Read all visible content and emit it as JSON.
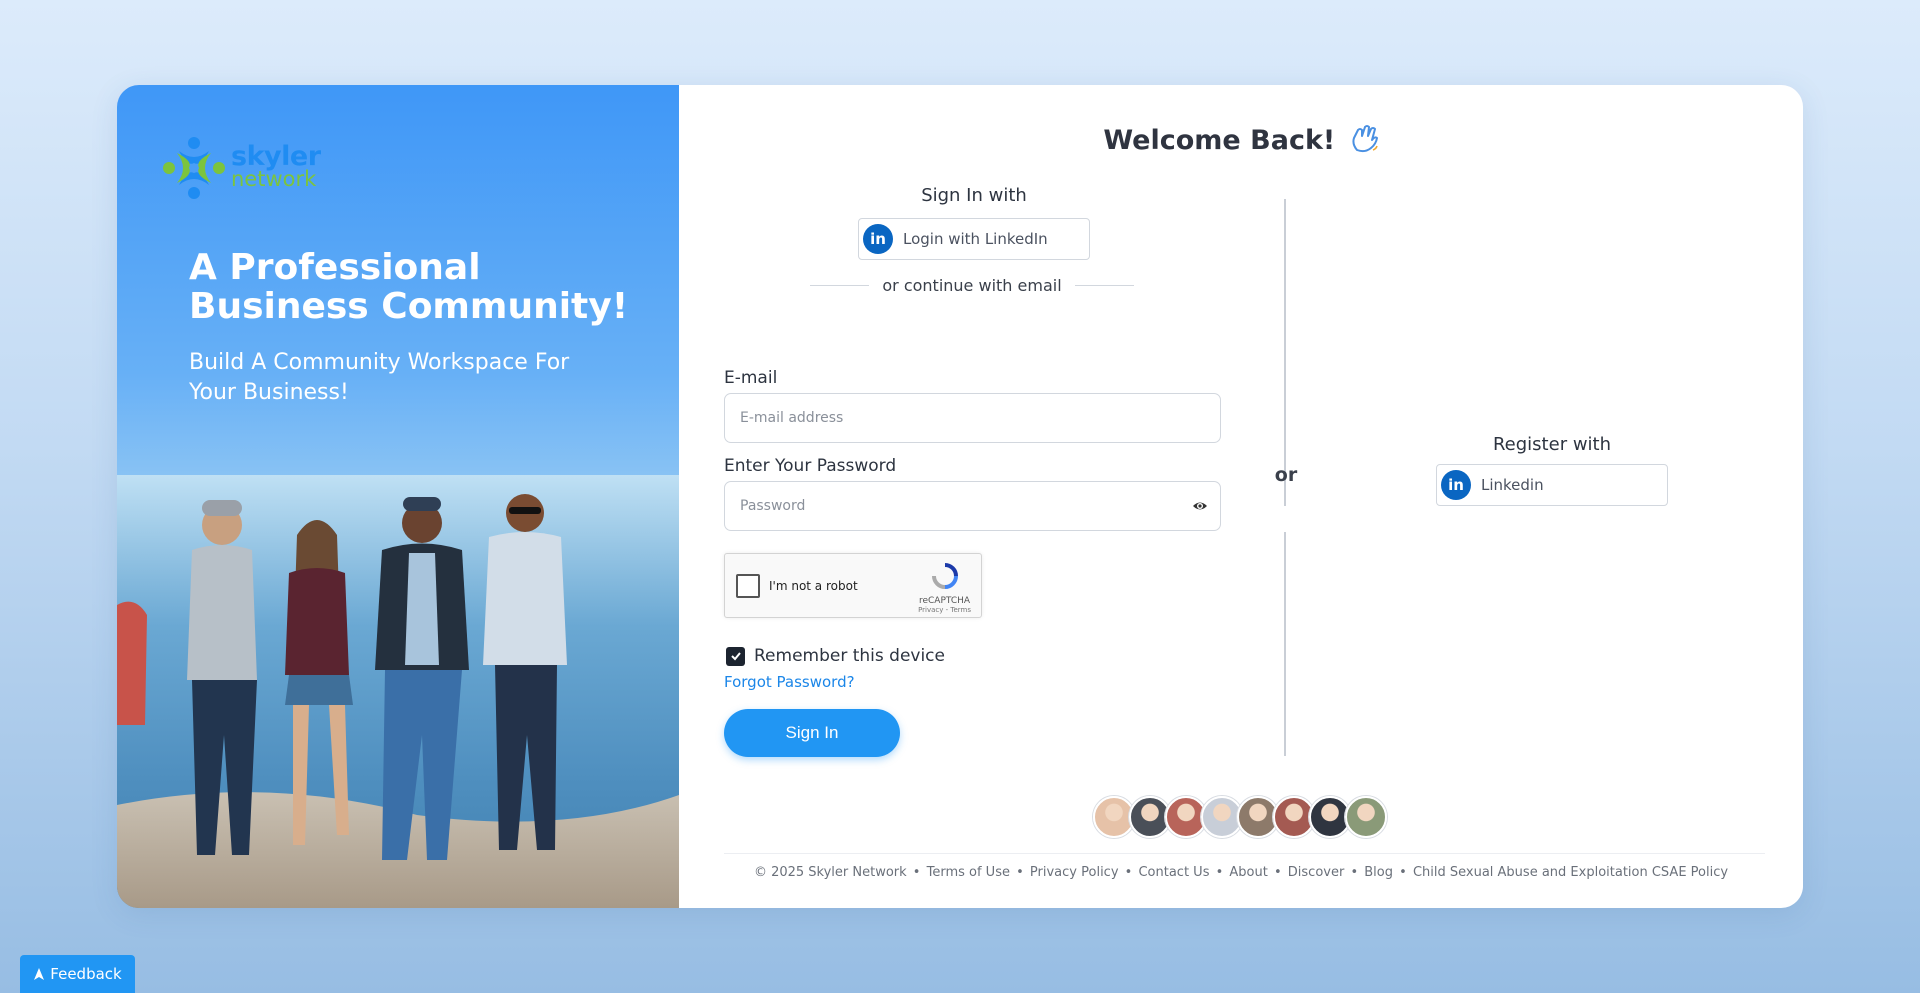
{
  "brand": {
    "logo_line1": "skyler",
    "logo_line2": "network"
  },
  "hero": {
    "title": "A Professional Business Community!",
    "subtitle": "Build A Community Workspace For Your Business!"
  },
  "welcome": {
    "title": "Welcome Back!",
    "icon": "waving-hand-icon"
  },
  "signin": {
    "heading": "Sign In with",
    "linkedin_label": "Login with LinkedIn",
    "divider": "or continue with email",
    "email_label": "E-mail",
    "email_placeholder": "E-mail address",
    "password_label": "Enter Your Password",
    "password_placeholder": "Password",
    "captcha_text": "I'm not a robot",
    "captcha_brand": "reCAPTCHA",
    "captcha_links": "Privacy - Terms",
    "remember_label": "Remember this device",
    "forgot_label": "Forgot Password?",
    "submit_label": "Sign In"
  },
  "separator": {
    "or_label": "or"
  },
  "register": {
    "heading": "Register with",
    "linkedin_label": "Linkedin"
  },
  "avatars": [
    {
      "color": "#e6c2a8"
    },
    {
      "color": "#4a4f58"
    },
    {
      "color": "#b8645a"
    },
    {
      "color": "#c8ced8"
    },
    {
      "color": "#8d7a6a"
    },
    {
      "color": "#a45a52"
    },
    {
      "color": "#2f3540"
    },
    {
      "color": "#8a9a78"
    }
  ],
  "footer": {
    "copyright": "© 2025 Skyler Network",
    "links": [
      "Terms of Use",
      "Privacy Policy",
      "Contact Us",
      "About",
      "Discover",
      "Blog",
      "Child Sexual Abuse and Exploitation CSAE Policy"
    ]
  },
  "feedback": {
    "label": "Feedback"
  },
  "colors": {
    "accent": "#2196f3",
    "linkedin": "#0a66c2",
    "link": "#1b86e8"
  }
}
